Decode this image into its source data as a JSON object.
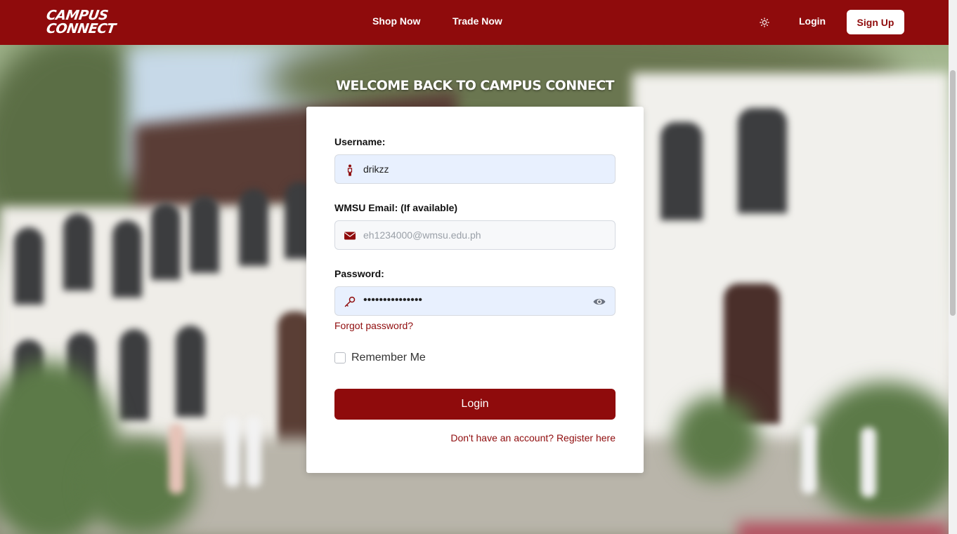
{
  "navbar": {
    "logo_line1": "CAMPUS",
    "logo_line2": "CONNECT",
    "links": [
      "Shop Now",
      "Trade Now"
    ],
    "theme_icon": "sun-icon",
    "login_label": "Login",
    "signup_label": "Sign Up"
  },
  "page": {
    "heading": "WELCOME BACK TO CAMPUS CONNECT"
  },
  "form": {
    "username_label": "Username:",
    "username_value": "drikzz",
    "username_icon": "person-icon",
    "email_label": "WMSU Email: (If available)",
    "email_placeholder": "eh1234000@wmsu.edu.ph",
    "email_icon": "envelope-icon",
    "password_label": "Password:",
    "password_value": "•••••••••••••••",
    "password_icon": "key-icon",
    "toggle_icon": "eye-icon",
    "forgot_label": "Forgot password?",
    "remember_label": "Remember Me",
    "remember_checked": false,
    "submit_label": "Login",
    "register_label": "Don't have an account? Register here"
  },
  "colors": {
    "brand": "#8f0b0c",
    "field_autofill": "#e8f0fe"
  }
}
